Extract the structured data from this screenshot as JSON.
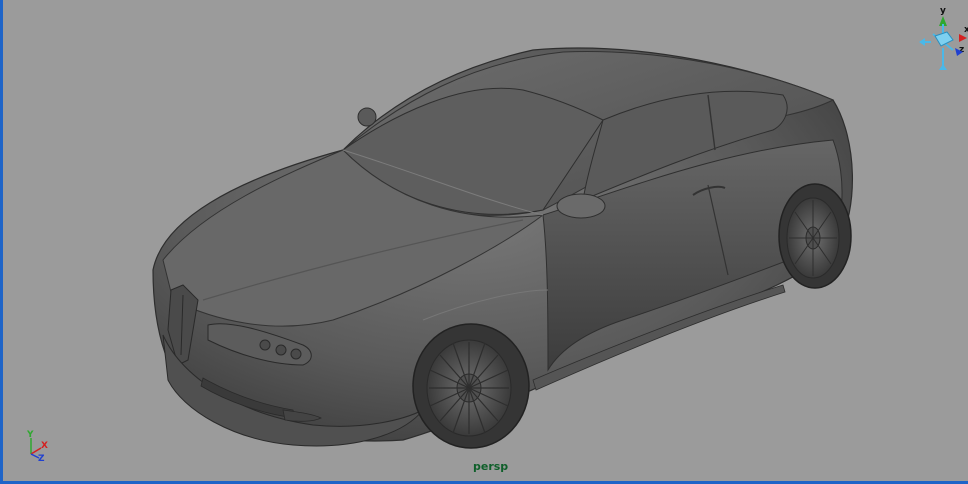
{
  "viewport": {
    "camera_name": "persp",
    "background_color": "#9b9b9b",
    "active_border_color": "#1e64c8"
  },
  "view_cube": {
    "axis_y_label": "y",
    "axis_x_label": "x",
    "axis_z_label": "z",
    "icon": "view-cube-icon"
  },
  "axis_gizmo": {
    "y_label": "Y",
    "x_label": "X",
    "z_label": "Z",
    "y_color": "#2fa82f",
    "x_color": "#d42020",
    "z_color": "#2040d0"
  },
  "model": {
    "icon": "car-model-icon"
  }
}
